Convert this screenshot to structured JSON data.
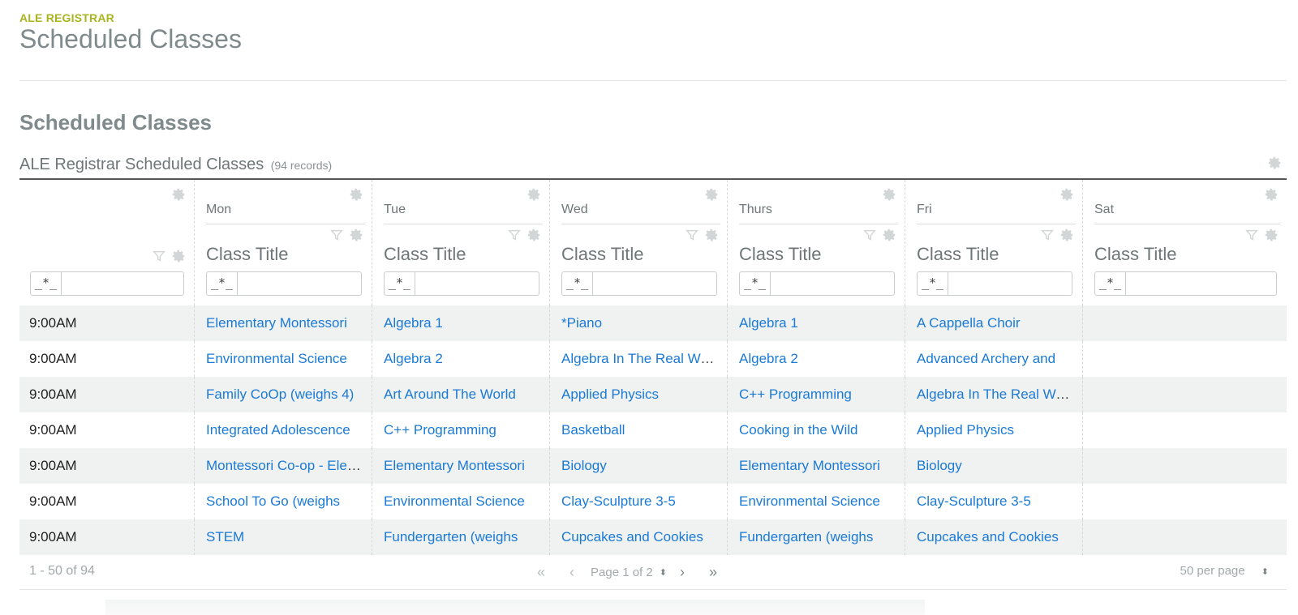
{
  "header": {
    "app_label": "ALE REGISTRAR",
    "page_title": "Scheduled Classes"
  },
  "section": {
    "title": "Scheduled Classes"
  },
  "table": {
    "title": "ALE Registrar Scheduled Classes",
    "record_count": "(94 records)",
    "field_label": "Class Title",
    "filter_mode": "_*_",
    "columns": [
      {
        "day": ""
      },
      {
        "day": "Mon"
      },
      {
        "day": "Tue"
      },
      {
        "day": "Wed"
      },
      {
        "day": "Thurs"
      },
      {
        "day": "Fri"
      },
      {
        "day": "Sat"
      }
    ],
    "rows": [
      {
        "time": "9:00AM",
        "classes": [
          "Elementary Montessori",
          "Algebra 1",
          "*Piano",
          "Algebra 1",
          "A Cappella Choir",
          ""
        ]
      },
      {
        "time": "9:00AM",
        "classes": [
          "Environmental Science",
          "Algebra 2",
          "Algebra In The Real World",
          "Algebra 2",
          "Advanced Archery and",
          ""
        ]
      },
      {
        "time": "9:00AM",
        "classes": [
          "Family CoOp (weighs 4)",
          "Art Around The World",
          "Applied Physics",
          "C++ Programming",
          "Algebra In The Real World",
          ""
        ]
      },
      {
        "time": "9:00AM",
        "classes": [
          "Integrated Adolescence",
          "C++ Programming",
          "Basketball",
          "Cooking in the Wild",
          "Applied Physics",
          ""
        ]
      },
      {
        "time": "9:00AM",
        "classes": [
          "Montessori Co-op - Elementary",
          "Elementary Montessori",
          "Biology",
          "Elementary Montessori",
          "Biology",
          ""
        ]
      },
      {
        "time": "9:00AM",
        "classes": [
          "School To Go (weighs",
          "Environmental Science",
          "Clay-Sculpture 3-5",
          "Environmental Science",
          "Clay-Sculpture 3-5",
          ""
        ]
      },
      {
        "time": "9:00AM",
        "classes": [
          "STEM",
          "Fundergarten (weighs",
          "Cupcakes and Cookies",
          "Fundergarten (weighs",
          "Cupcakes and Cookies",
          ""
        ]
      }
    ]
  },
  "pager": {
    "range": "1 - 50 of 94",
    "first": "«",
    "prev": "‹",
    "page_text": "Page 1 of 2",
    "spinner": "⬍",
    "next": "›",
    "last": "»",
    "per_page": "50 per page"
  },
  "icons": {
    "gear": "gear-icon",
    "filter": "filter-icon"
  },
  "colors": {
    "accent": "#a8b520",
    "link": "#1a7ad6",
    "title_gray": "#7f8a8c",
    "stripe": "#f0f1f1"
  }
}
